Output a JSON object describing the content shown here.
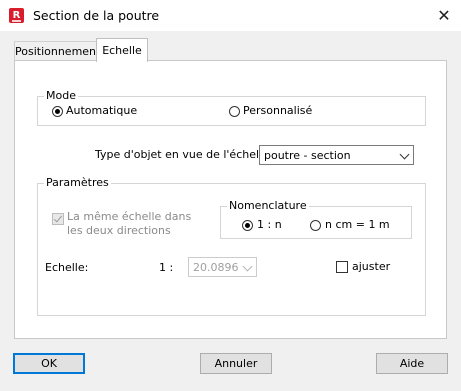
{
  "window": {
    "title": "Section de la poutre",
    "app_icon_letter": "R"
  },
  "tabs": [
    {
      "label": "Positionnement"
    },
    {
      "label": "Echelle"
    }
  ],
  "mode": {
    "legend": "Mode",
    "options": [
      {
        "label": "Automatique",
        "selected": true
      },
      {
        "label": "Personnalisé",
        "selected": false
      }
    ]
  },
  "object_type": {
    "label": "Type d'objet en vue de l'échelle:",
    "value": "poutre - section"
  },
  "parametres": {
    "legend": "Paramètres",
    "same_scale_label": "La même échelle dans les deux directions",
    "same_scale_checked": true,
    "nomenclature": {
      "legend": "Nomenclature",
      "options": [
        {
          "label": "1 : n",
          "selected": true
        },
        {
          "label": "n cm = 1 m",
          "selected": false
        }
      ]
    },
    "echelle_label": "Echelle:",
    "ratio_prefix": "1 :",
    "scale_value": "20.0896",
    "ajuster_label": "ajuster",
    "ajuster_checked": false
  },
  "buttons": {
    "ok": "OK",
    "cancel": "Annuler",
    "help": "Aide"
  }
}
